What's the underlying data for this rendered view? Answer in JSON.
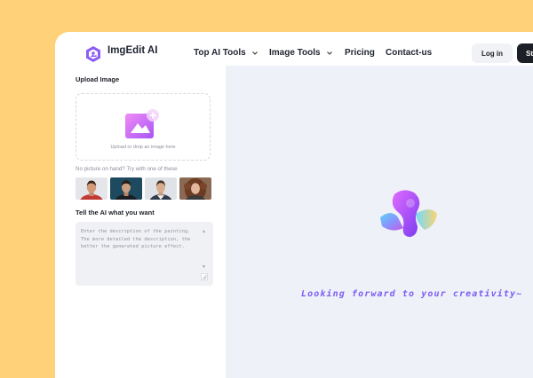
{
  "header": {
    "brand": "ImgEdit AI",
    "nav": [
      {
        "label": "Top AI Tools",
        "dropdown": true
      },
      {
        "label": "Image Tools",
        "dropdown": true
      },
      {
        "label": "Pricing",
        "dropdown": false
      },
      {
        "label": "Contact-us",
        "dropdown": false
      }
    ],
    "login_label": "Log in",
    "start_label": "Sta"
  },
  "upload": {
    "title": "Upload Image",
    "drop_text": "Upload or drop an image here",
    "sample_hint": "No picture on hand? Try with one of these"
  },
  "prompt": {
    "title": "Tell the AI what you want",
    "placeholder": "Enter the description of the painting. The more detailed the description, the better the generated picture effect."
  },
  "preview": {
    "tagline": "Looking forward to your creativity~"
  },
  "colors": {
    "outer_background": "#ffd27a",
    "accent_purple": "#7b5cf5",
    "dark_button": "#1d1f26"
  }
}
